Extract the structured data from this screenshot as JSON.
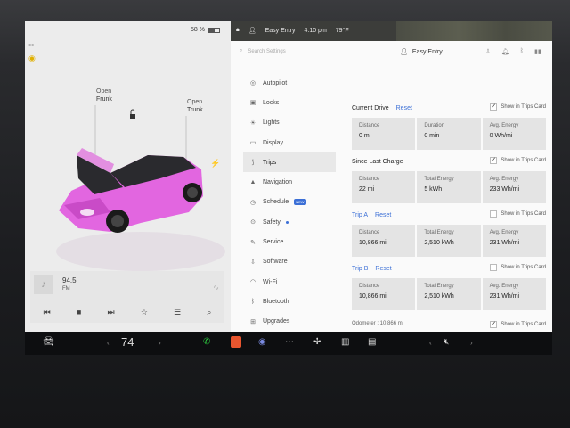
{
  "status": {
    "battery_pct": "58 %",
    "profile": "Easy Entry",
    "time": "4:10 pm",
    "temp": "79°F"
  },
  "car_panel": {
    "frunk_open": "Open",
    "frunk_label": "Frunk",
    "trunk_open": "Open",
    "trunk_label": "Trunk",
    "car_color": "#e266e0"
  },
  "media": {
    "frequency": "94.5",
    "band": "FM"
  },
  "settings": {
    "search_placeholder": "Search Settings",
    "profile_name": "Easy Entry",
    "menu": [
      {
        "label": "Autopilot",
        "icon": "steering-wheel-icon"
      },
      {
        "label": "Locks",
        "icon": "lock-icon"
      },
      {
        "label": "Lights",
        "icon": "light-bulb-icon"
      },
      {
        "label": "Display",
        "icon": "display-icon"
      },
      {
        "label": "Trips",
        "icon": "trips-icon"
      },
      {
        "label": "Navigation",
        "icon": "navigation-icon"
      },
      {
        "label": "Schedule",
        "icon": "clock-icon",
        "badge": "NEW"
      },
      {
        "label": "Safety",
        "icon": "safety-icon"
      },
      {
        "label": "Service",
        "icon": "wrench-icon"
      },
      {
        "label": "Software",
        "icon": "download-icon"
      },
      {
        "label": "Wi-Fi",
        "icon": "wifi-icon"
      },
      {
        "label": "Bluetooth",
        "icon": "bluetooth-icon"
      },
      {
        "label": "Upgrades",
        "icon": "upgrades-icon"
      }
    ],
    "show_in_trips": "Show in Trips Card",
    "reset": "Reset",
    "current_drive": {
      "title": "Current Drive",
      "labels": [
        "Distance",
        "Duration",
        "Avg. Energy"
      ],
      "values": [
        "0 mi",
        "0 min",
        "0 Wh/mi"
      ]
    },
    "since_last_charge": {
      "title": "Since Last Charge",
      "labels": [
        "Distance",
        "Total Energy",
        "Avg. Energy"
      ],
      "values": [
        "22 mi",
        "5 kWh",
        "233 Wh/mi"
      ]
    },
    "trip_a": {
      "title": "Trip A",
      "labels": [
        "Distance",
        "Total Energy",
        "Avg. Energy"
      ],
      "values": [
        "10,866 mi",
        "2,510 kWh",
        "231 Wh/mi"
      ]
    },
    "trip_b": {
      "title": "Trip B",
      "labels": [
        "Distance",
        "Total Energy",
        "Avg. Energy"
      ],
      "values": [
        "10,866 mi",
        "2,510 kWh",
        "231 Wh/mi"
      ]
    },
    "odometer": "Odometer : 10,866 mi"
  },
  "taskbar": {
    "temperature": "74",
    "accent_colors": {
      "phone": "#2ecc40",
      "audio": "#e8562f"
    }
  }
}
